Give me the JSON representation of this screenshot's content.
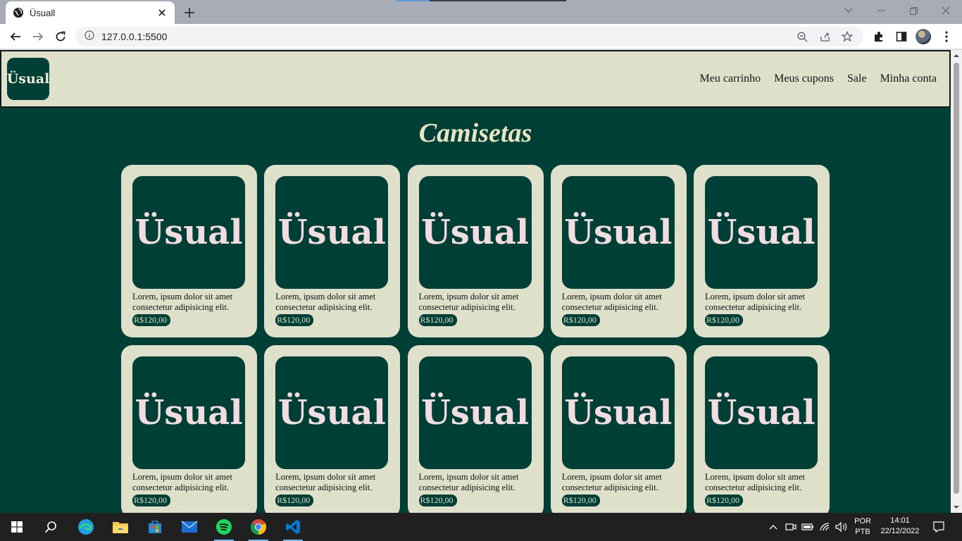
{
  "browser": {
    "tab_title": "Üsuall",
    "url": "127.0.0.1:5500"
  },
  "site": {
    "logo_text": "Üsual",
    "nav": [
      {
        "label": "Meu carrinho"
      },
      {
        "label": "Meus cupons"
      },
      {
        "label": "Sale"
      },
      {
        "label": "Minha conta"
      }
    ],
    "page_title": "Camisetas",
    "products": [
      {
        "image_text": "Üsual",
        "description": "Lorem, ipsum dolor sit amet consectetur adipisicing elit.",
        "price": "R$120,00"
      },
      {
        "image_text": "Üsual",
        "description": "Lorem, ipsum dolor sit amet consectetur adipisicing elit.",
        "price": "R$120,00"
      },
      {
        "image_text": "Üsual",
        "description": "Lorem, ipsum dolor sit amet consectetur adipisicing elit.",
        "price": "R$120,00"
      },
      {
        "image_text": "Üsual",
        "description": "Lorem, ipsum dolor sit amet consectetur adipisicing elit.",
        "price": "R$120,00"
      },
      {
        "image_text": "Üsual",
        "description": "Lorem, ipsum dolor sit amet consectetur adipisicing elit.",
        "price": "R$120,00"
      },
      {
        "image_text": "Üsual",
        "description": "Lorem, ipsum dolor sit amet consectetur adipisicing elit.",
        "price": "R$120,00"
      },
      {
        "image_text": "Üsual",
        "description": "Lorem, ipsum dolor sit amet consectetur adipisicing elit.",
        "price": "R$120,00"
      },
      {
        "image_text": "Üsual",
        "description": "Lorem, ipsum dolor sit amet consectetur adipisicing elit.",
        "price": "R$120,00"
      },
      {
        "image_text": "Üsual",
        "description": "Lorem, ipsum dolor sit amet consectetur adipisicing elit.",
        "price": "R$120,00"
      },
      {
        "image_text": "Üsual",
        "description": "Lorem, ipsum dolor sit amet consectetur adipisicing elit.",
        "price": "R$120,00"
      }
    ]
  },
  "taskbar": {
    "language_line1": "POR",
    "language_line2": "PTB",
    "time": "14:01",
    "date": "22/12/2022"
  },
  "colors": {
    "page_background": "#003f36",
    "card_background": "#dfe0c9",
    "logo_text": "#f1dcdf"
  }
}
